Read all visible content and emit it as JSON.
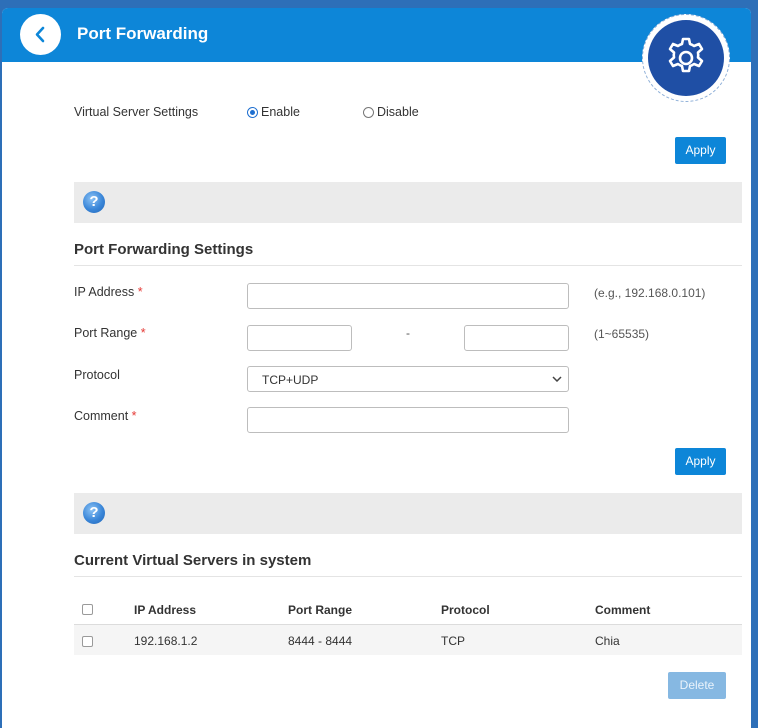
{
  "header": {
    "title": "Port Forwarding"
  },
  "virtual_server": {
    "label": "Virtual Server Settings",
    "enable_label": "Enable",
    "disable_label": "Disable",
    "selected": "Enable",
    "apply_label": "Apply"
  },
  "port_forwarding": {
    "title": "Port Forwarding Settings",
    "ip_label": "IP Address",
    "ip_value": "",
    "ip_hint": "(e.g., 192.168.0.101)",
    "port_label": "Port Range",
    "port_start": "",
    "port_end": "",
    "port_separator": "-",
    "port_hint": "(1~65535)",
    "protocol_label": "Protocol",
    "protocol_value": "TCP+UDP",
    "comment_label": "Comment",
    "comment_value": "",
    "required_mark": "*",
    "apply_label": "Apply"
  },
  "current_servers": {
    "title": "Current Virtual Servers in system",
    "columns": [
      "IP Address",
      "Port Range",
      "Protocol",
      "Comment"
    ],
    "rows": [
      {
        "ip": "192.168.1.2",
        "port_range": "8444 - 8444",
        "protocol": "TCP",
        "comment": "Chia"
      }
    ],
    "delete_label": "Delete"
  },
  "icons": {
    "back": "back-arrow-icon",
    "settings": "gear-icon",
    "help": "help-icon"
  },
  "colors": {
    "header_blue": "#0d86d8",
    "gear_blue": "#1f4fa5",
    "required_red": "#e53935"
  }
}
